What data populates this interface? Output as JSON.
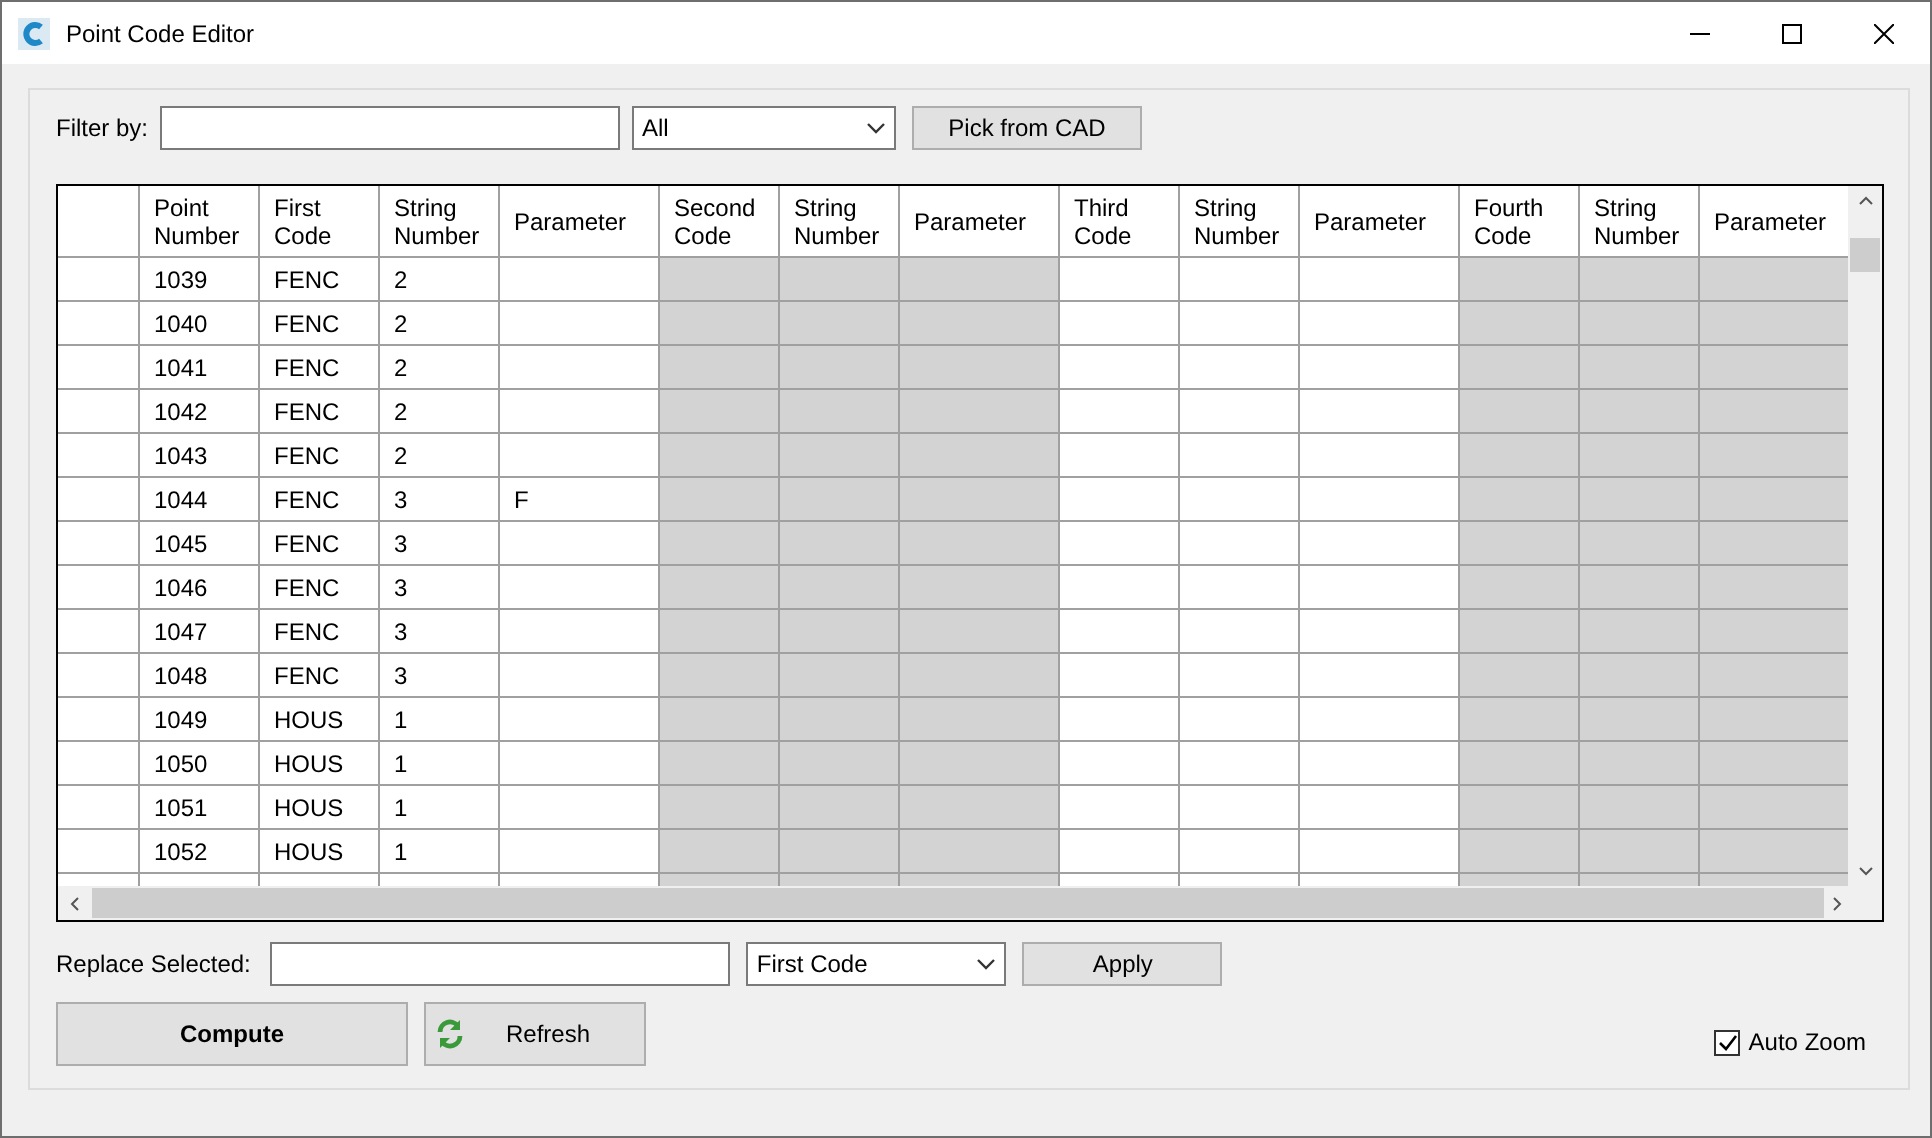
{
  "window": {
    "title": "Point Code Editor"
  },
  "filter": {
    "label": "Filter by:",
    "dropdown": "All",
    "pick_button": "Pick from CAD"
  },
  "table": {
    "columns": [
      {
        "label": "Point Number",
        "shaded": false
      },
      {
        "label": "First Code",
        "shaded": false
      },
      {
        "label": "String Number",
        "shaded": false
      },
      {
        "label": "Parameter",
        "shaded": false
      },
      {
        "label": "Second Code",
        "shaded": true
      },
      {
        "label": "String Number",
        "shaded": true
      },
      {
        "label": "Parameter",
        "shaded": true
      },
      {
        "label": "Third Code",
        "shaded": false
      },
      {
        "label": "String Number",
        "shaded": false
      },
      {
        "label": "Parameter",
        "shaded": false
      },
      {
        "label": "Fourth Code",
        "shaded": true
      },
      {
        "label": "String Number",
        "shaded": true
      },
      {
        "label": "Parameter",
        "shaded": true
      }
    ],
    "rows": [
      {
        "point_number": "1039",
        "first_code": "FENC",
        "string_number": "2"
      },
      {
        "point_number": "1040",
        "first_code": "FENC",
        "string_number": "2"
      },
      {
        "point_number": "1041",
        "first_code": "FENC",
        "string_number": "2"
      },
      {
        "point_number": "1042",
        "first_code": "FENC",
        "string_number": "2"
      },
      {
        "point_number": "1043",
        "first_code": "FENC",
        "string_number": "2"
      },
      {
        "point_number": "1044",
        "first_code": "FENC",
        "string_number": "3",
        "parameter": "F"
      },
      {
        "point_number": "1045",
        "first_code": "FENC",
        "string_number": "3"
      },
      {
        "point_number": "1046",
        "first_code": "FENC",
        "string_number": "3"
      },
      {
        "point_number": "1047",
        "first_code": "FENC",
        "string_number": "3"
      },
      {
        "point_number": "1048",
        "first_code": "FENC",
        "string_number": "3"
      },
      {
        "point_number": "1049",
        "first_code": "HOUS",
        "string_number": "1"
      },
      {
        "point_number": "1050",
        "first_code": "HOUS",
        "string_number": "1"
      },
      {
        "point_number": "1051",
        "first_code": "HOUS",
        "string_number": "1"
      },
      {
        "point_number": "1052",
        "first_code": "HOUS",
        "string_number": "1"
      }
    ]
  },
  "replace": {
    "label": "Replace Selected:",
    "dropdown": "First Code",
    "apply_button": "Apply"
  },
  "buttons": {
    "compute": "Compute",
    "refresh": "Refresh"
  },
  "auto_zoom": {
    "label": "Auto Zoom",
    "checked": true
  }
}
